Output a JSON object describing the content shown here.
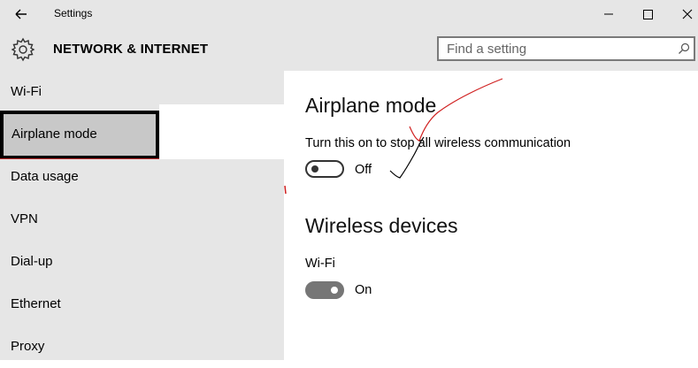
{
  "window": {
    "app_title": "Settings",
    "back_icon": "arrow-left-icon",
    "minimize_icon": "minimize-icon",
    "maximize_icon": "maximize-icon",
    "close_icon": "close-icon"
  },
  "header": {
    "section_title": "NETWORK & INTERNET",
    "gear_icon": "gear-icon"
  },
  "search": {
    "placeholder": "Find a setting",
    "icon": "search-icon"
  },
  "sidebar": {
    "items": [
      {
        "label": "Wi-Fi",
        "selected": false
      },
      {
        "label": "Airplane mode",
        "selected": true
      },
      {
        "label": "Data usage",
        "selected": false
      },
      {
        "label": "VPN",
        "selected": false
      },
      {
        "label": "Dial-up",
        "selected": false
      },
      {
        "label": "Ethernet",
        "selected": false
      },
      {
        "label": "Proxy",
        "selected": false
      }
    ]
  },
  "main": {
    "airplane": {
      "heading": "Airplane mode",
      "description": "Turn this on to stop all wireless communication",
      "toggle_state": "Off"
    },
    "wireless": {
      "heading": "Wireless devices",
      "wifi_label": "Wi-Fi",
      "wifi_state": "On"
    }
  },
  "colors": {
    "sidebar_bg": "#e6e6e6",
    "selected_bg": "#c8c8c8",
    "toggle_on": "#767676",
    "annotation_red": "#d02020"
  }
}
